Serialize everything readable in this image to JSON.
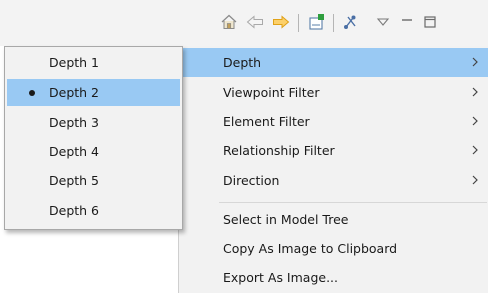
{
  "toolbar": {
    "icons": [
      "home-icon",
      "back-arrow-icon",
      "forward-arrow-icon",
      "new-viewpoint-icon",
      "layout-icon",
      "view-menu-icon",
      "minimize-icon",
      "maximize-icon"
    ]
  },
  "context_menu": {
    "items": [
      {
        "label": "Depth",
        "submenu": true,
        "active": true
      },
      {
        "label": "Viewpoint Filter",
        "submenu": true
      },
      {
        "label": "Element Filter",
        "submenu": true
      },
      {
        "label": "Relationship Filter",
        "submenu": true
      },
      {
        "label": "Direction",
        "submenu": true
      },
      {
        "label": "Select in Model Tree",
        "submenu": false
      },
      {
        "label": "Copy As Image to Clipboard",
        "submenu": false
      },
      {
        "label": "Export As Image...",
        "submenu": false
      }
    ]
  },
  "depth_submenu": {
    "items": [
      {
        "label": "Depth 1",
        "selected": false
      },
      {
        "label": "Depth 2",
        "selected": true
      },
      {
        "label": "Depth 3",
        "selected": false
      },
      {
        "label": "Depth 4",
        "selected": false
      },
      {
        "label": "Depth 5",
        "selected": false
      },
      {
        "label": "Depth 6",
        "selected": false
      }
    ]
  },
  "colors": {
    "highlight": "#99c9f3",
    "menu_bg": "#f2f2f2",
    "toolbar_bg": "#f3f3f3",
    "forward_arrow": "#f0b429",
    "new_icon": "#2e9e3e"
  }
}
